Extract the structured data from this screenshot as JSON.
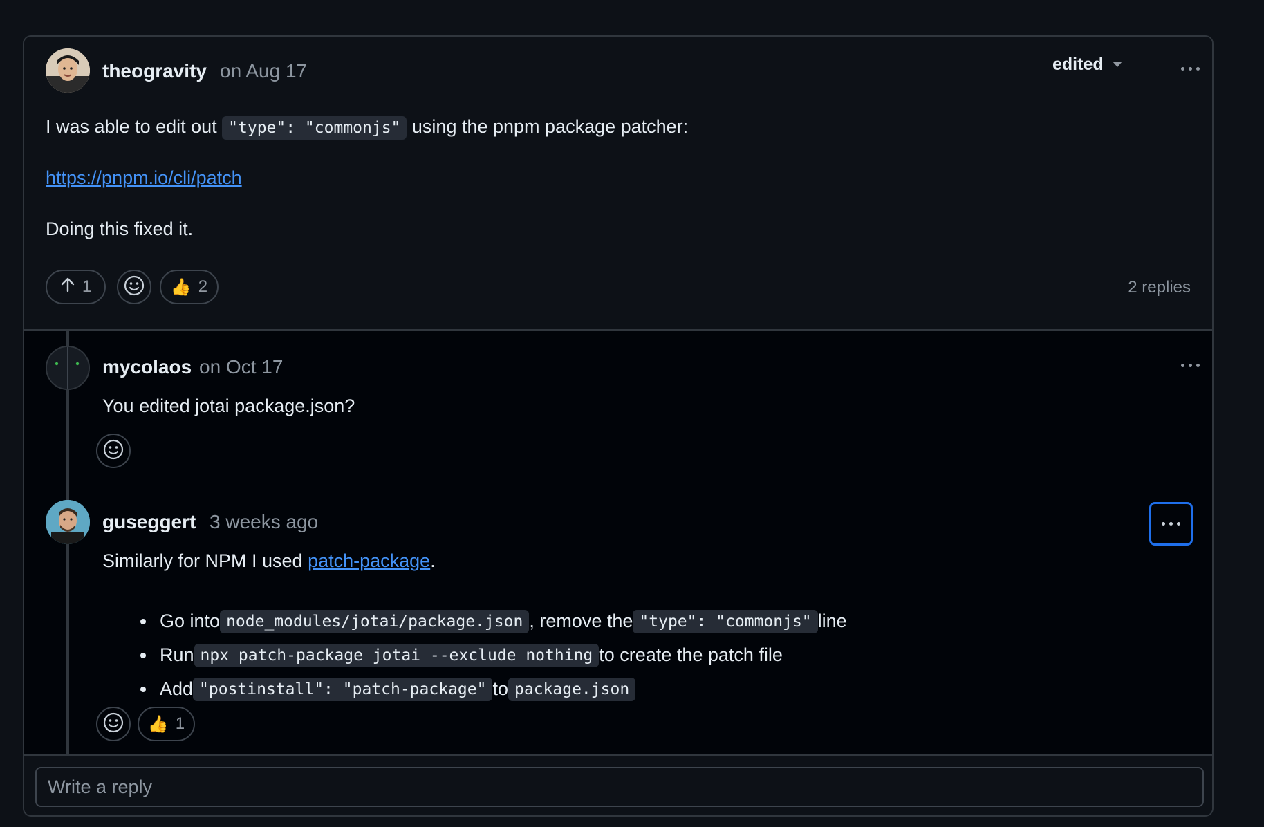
{
  "comment": {
    "author": "theogravity",
    "time": "on Aug 17",
    "edited_label": "edited",
    "line1_before": "I was able to edit out ",
    "line1_code": "\"type\": \"commonjs\"",
    "line1_after": " using the pnpm package patcher:",
    "link": "https://pnpm.io/cli/patch",
    "line3": "Doing this fixed it.",
    "upvote_count": "1",
    "thumbs_count": "2",
    "replies_label": "2 replies"
  },
  "replies": [
    {
      "author": "mycolaos",
      "time": "on Oct 17",
      "text": "You edited jotai package.json?"
    },
    {
      "author": "guseggert",
      "time": "3 weeks ago",
      "text_before": "Similarly for NPM I used ",
      "link": "patch-package",
      "text_after": ".",
      "steps": [
        {
          "pre": "Go into ",
          "code1": "node_modules/jotai/package.json",
          "mid": ", remove the ",
          "code2": "\"type\": \"commonjs\"",
          "post": " line"
        },
        {
          "pre": "Run ",
          "code1": "npx patch-package jotai --exclude nothing",
          "mid": " to create the patch file",
          "code2": "",
          "post": ""
        },
        {
          "pre": "Add ",
          "code1": "\"postinstall\": \"patch-package\"",
          "mid": " to ",
          "code2": "package.json",
          "post": ""
        }
      ],
      "thumbs_count": "1"
    }
  ],
  "reply_box": {
    "placeholder": "Write a reply"
  },
  "icons": {
    "upvote": "arrow-up-icon",
    "emoji": "smiley-icon",
    "thumbs": "thumbs-up-icon",
    "more": "kebab-horizontal-icon",
    "dropdown": "triangle-down-icon"
  },
  "colors": {
    "accent": "#4493f8",
    "focus": "#1f6feb",
    "bg": "#0d1117"
  }
}
